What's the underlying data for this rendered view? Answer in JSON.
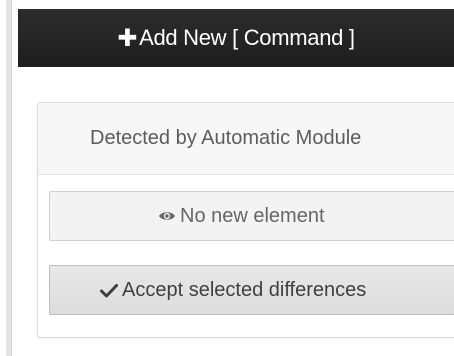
{
  "toolbar": {
    "add_icon": "plus-icon",
    "add_label": "Add New [ Command ]"
  },
  "panel": {
    "heading": "Detected by Automatic Module",
    "status_icon": "eye-icon",
    "status_label": "No new element",
    "accept_icon": "check-icon",
    "accept_label": "Accept selected differences"
  },
  "colors": {
    "toolbar_bg": "#222222",
    "toolbar_text": "#ffffff",
    "heading_bg": "#f7f7f7",
    "button_bg": "#e3e3e3"
  }
}
